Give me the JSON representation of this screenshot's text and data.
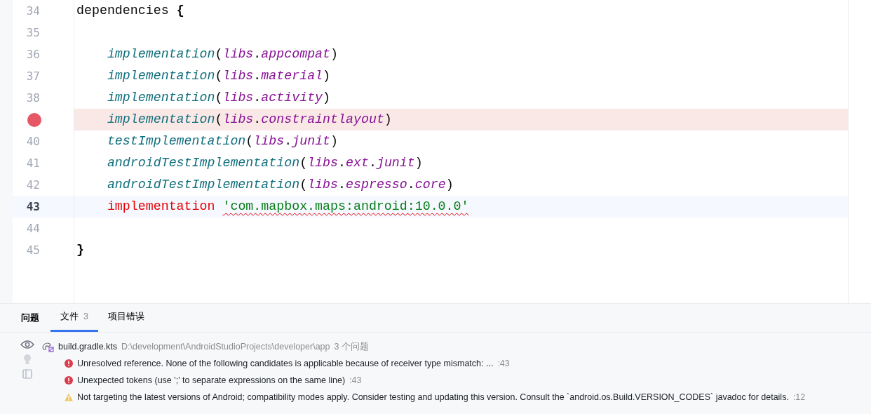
{
  "editor": {
    "lines": [
      {
        "number": "34",
        "breakpoint": false,
        "current": false,
        "tokens": [
          {
            "kind": "plain",
            "text": "dependencies"
          },
          {
            "kind": "brace",
            "text": "{"
          }
        ]
      },
      {
        "number": "35",
        "breakpoint": false,
        "current": false
      },
      {
        "number": "36",
        "breakpoint": false,
        "current": false,
        "tokens": [
          {
            "kind": "indent"
          },
          {
            "kind": "function",
            "text": "implementation"
          },
          {
            "kind": "punct",
            "text": "("
          },
          {
            "kind": "member",
            "text": "libs"
          },
          {
            "kind": "punct",
            "text": "."
          },
          {
            "kind": "member",
            "text": "appcompat"
          },
          {
            "kind": "punct",
            "text": ")"
          }
        ]
      },
      {
        "number": "37",
        "breakpoint": false,
        "current": false,
        "tokens": [
          {
            "kind": "indent"
          },
          {
            "kind": "function",
            "text": "implementation"
          },
          {
            "kind": "punct",
            "text": "("
          },
          {
            "kind": "member",
            "text": "libs"
          },
          {
            "kind": "punct",
            "text": "."
          },
          {
            "kind": "member",
            "text": "material"
          },
          {
            "kind": "punct",
            "text": ")"
          }
        ]
      },
      {
        "number": "38",
        "breakpoint": false,
        "current": false,
        "tokens": [
          {
            "kind": "indent"
          },
          {
            "kind": "function",
            "text": "implementation"
          },
          {
            "kind": "punct",
            "text": "("
          },
          {
            "kind": "member",
            "text": "libs"
          },
          {
            "kind": "punct",
            "text": "."
          },
          {
            "kind": "member",
            "text": "activity"
          },
          {
            "kind": "punct",
            "text": ")"
          }
        ]
      },
      {
        "breakpoint": true,
        "current": false,
        "tokens": [
          {
            "kind": "indent"
          },
          {
            "kind": "function",
            "text": "implementation"
          },
          {
            "kind": "punct",
            "text": "("
          },
          {
            "kind": "member",
            "text": "libs"
          },
          {
            "kind": "punct",
            "text": "."
          },
          {
            "kind": "member",
            "text": "constraintlayout"
          },
          {
            "kind": "punct",
            "text": ")"
          }
        ]
      },
      {
        "number": "40",
        "breakpoint": false,
        "current": false,
        "tokens": [
          {
            "kind": "indent"
          },
          {
            "kind": "function",
            "text": "testImplementation"
          },
          {
            "kind": "punct",
            "text": "("
          },
          {
            "kind": "member",
            "text": "libs"
          },
          {
            "kind": "punct",
            "text": "."
          },
          {
            "kind": "member",
            "text": "junit"
          },
          {
            "kind": "punct",
            "text": ")"
          }
        ]
      },
      {
        "number": "41",
        "breakpoint": false,
        "current": false,
        "tokens": [
          {
            "kind": "indent"
          },
          {
            "kind": "function",
            "text": "androidTestImplementation"
          },
          {
            "kind": "punct",
            "text": "("
          },
          {
            "kind": "member",
            "text": "libs"
          },
          {
            "kind": "punct",
            "text": "."
          },
          {
            "kind": "member",
            "text": "ext"
          },
          {
            "kind": "punct",
            "text": "."
          },
          {
            "kind": "member",
            "text": "junit"
          },
          {
            "kind": "punct",
            "text": ")"
          }
        ]
      },
      {
        "number": "42",
        "breakpoint": false,
        "current": false,
        "tokens": [
          {
            "kind": "indent"
          },
          {
            "kind": "function",
            "text": "androidTestImplementation"
          },
          {
            "kind": "punct",
            "text": "("
          },
          {
            "kind": "member",
            "text": "libs"
          },
          {
            "kind": "punct",
            "text": "."
          },
          {
            "kind": "member",
            "text": "espresso"
          },
          {
            "kind": "punct",
            "text": "."
          },
          {
            "kind": "member",
            "text": "core"
          },
          {
            "kind": "punct",
            "text": ")"
          }
        ]
      },
      {
        "number": "43",
        "breakpoint": false,
        "current": true,
        "tokens": [
          {
            "kind": "indent"
          },
          {
            "kind": "unresolved",
            "text": "implementation"
          },
          {
            "kind": "string",
            "text": "'com.mapbox.maps:android:10.0.0'",
            "error_underline": true
          }
        ]
      },
      {
        "number": "44",
        "breakpoint": false,
        "current": false
      },
      {
        "number": "45",
        "breakpoint": false,
        "current": false,
        "tokens": [
          {
            "kind": "brace",
            "text": "}"
          }
        ]
      }
    ]
  },
  "problems_panel": {
    "title": "问题",
    "tabs": [
      {
        "label": "文件",
        "count": "3",
        "selected": true
      },
      {
        "label": "项目错误",
        "selected": false
      }
    ],
    "file": {
      "name": "build.gradle.kts",
      "path": "D:\\development\\AndroidStudioProjects\\developer\\app",
      "count": "3 个问题"
    },
    "problems": [
      {
        "kind": "error",
        "message": "Unresolved reference. None of the following candidates is applicable because of receiver type mismatch: ...",
        "location": ":43"
      },
      {
        "kind": "error",
        "message": "Unexpected tokens (use ';' to separate expressions on the same line)",
        "location": ":43"
      },
      {
        "kind": "warning",
        "message": "Not targeting the latest versions of Android; compatibility modes apply. Consider testing and updating this version. Consult the `android.os.Build.VERSION_CODES` javadoc for details.",
        "location": ":12"
      }
    ]
  }
}
